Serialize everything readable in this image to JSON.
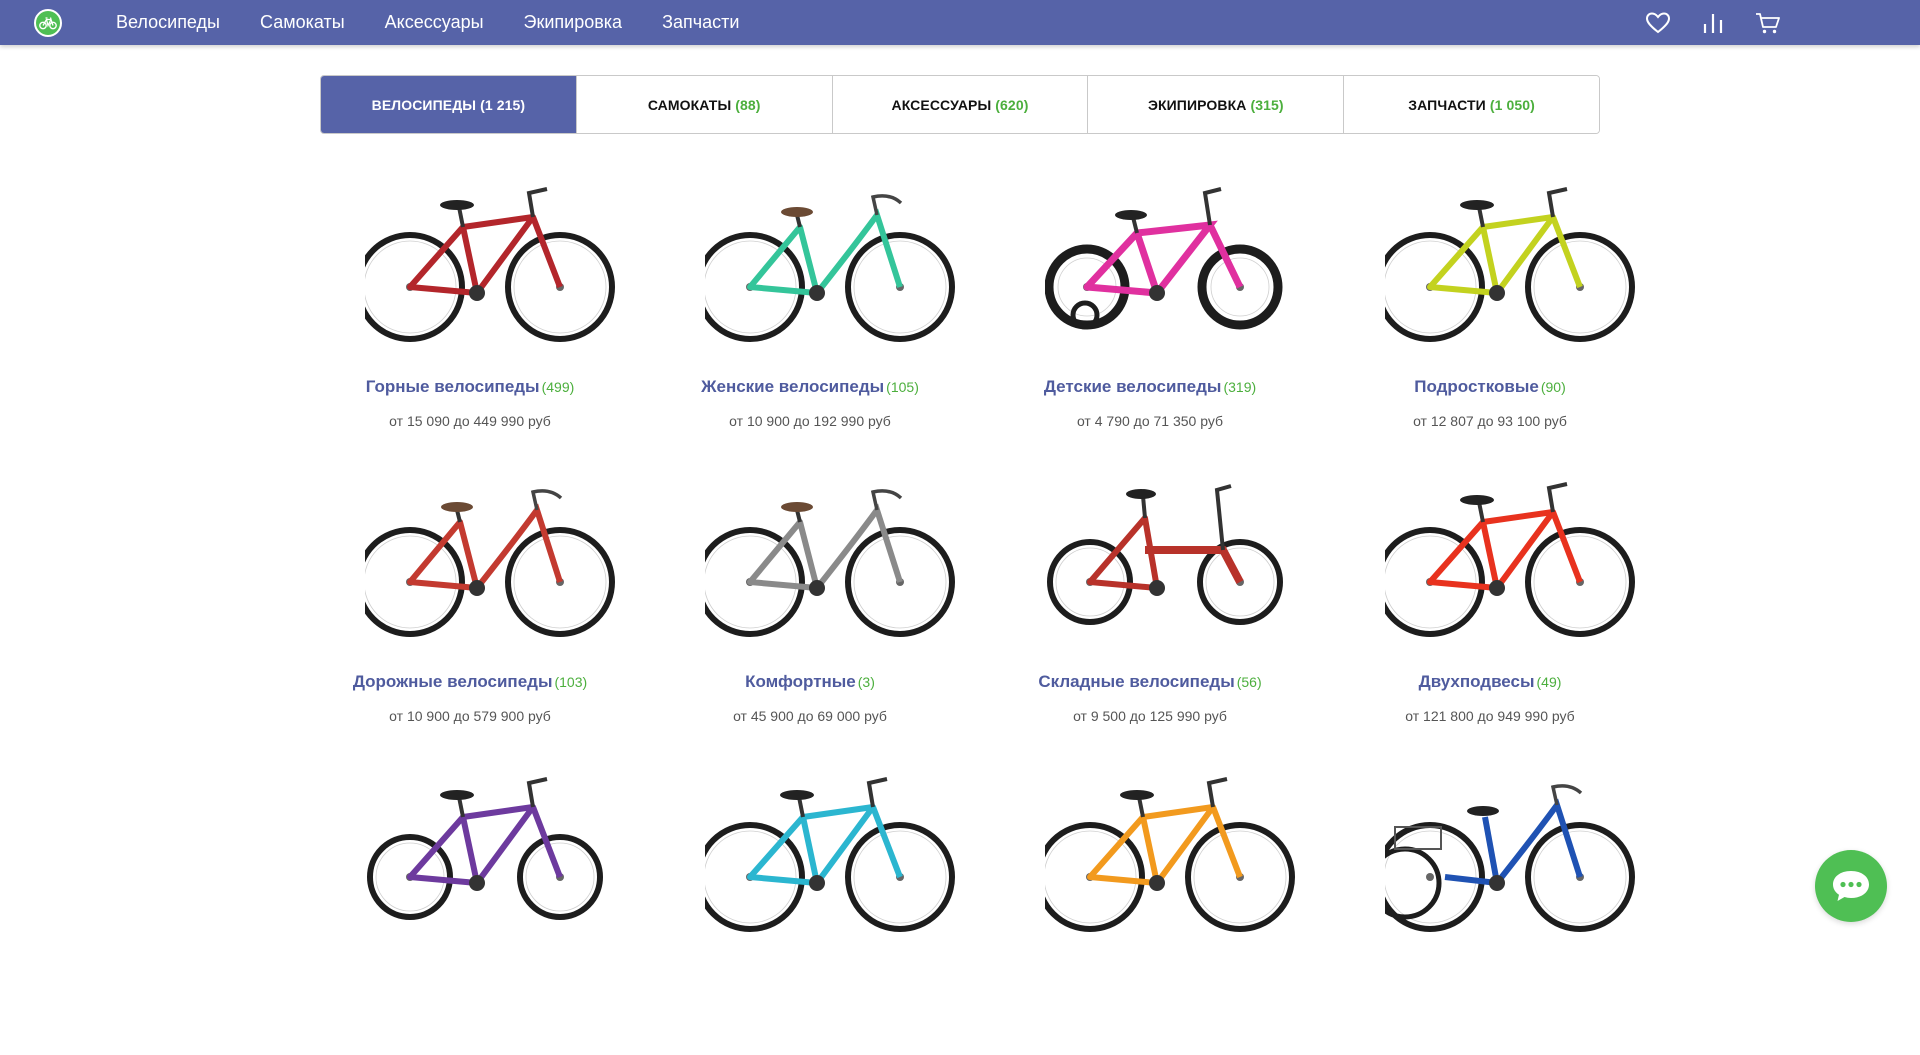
{
  "header": {
    "logo_icon": "bicycle-logo-icon",
    "nav": [
      {
        "label": "Велосипеды"
      },
      {
        "label": "Самокаты"
      },
      {
        "label": "Аксессуары"
      },
      {
        "label": "Экипировка"
      },
      {
        "label": "Запчасти"
      }
    ],
    "icons": [
      "heart-icon",
      "compare-icon",
      "cart-icon"
    ]
  },
  "tabs": [
    {
      "label": "ВЕЛОСИПЕДЫ",
      "count": "(1 215)",
      "active": true
    },
    {
      "label": "САМОКАТЫ",
      "count": "(88)",
      "active": false
    },
    {
      "label": "АКСЕССУАРЫ",
      "count": "(620)",
      "active": false
    },
    {
      "label": "ЭКИПИРОВКА",
      "count": "(315)",
      "active": false
    },
    {
      "label": "ЗАПЧАСТИ",
      "count": "(1 050)",
      "active": false
    }
  ],
  "products": [
    {
      "title": "Горные велосипеды",
      "count": "(499)",
      "price": "от 15 090 до 449 990 руб",
      "color": "#b3262b",
      "kind": "mtb"
    },
    {
      "title": "Женские велосипеды",
      "count": "(105)",
      "price": "от 10 900 до 192 990 руб",
      "color": "#34c59a",
      "kind": "city"
    },
    {
      "title": "Детские велосипеды",
      "count": "(319)",
      "price": "от 4 790 до 71 350 руб",
      "color": "#e0309f",
      "kind": "kids"
    },
    {
      "title": "Подростковые",
      "count": "(90)",
      "price": "от 12 807 до 93 100 руб",
      "color": "#c3d21f",
      "kind": "mtb"
    },
    {
      "title": "Дорожные велосипеды",
      "count": "(103)",
      "price": "от 10 900 до 579 900 руб",
      "color": "#c33a30",
      "kind": "city"
    },
    {
      "title": "Комфортные",
      "count": "(3)",
      "price": "от 45 900 до 69 000 руб",
      "color": "#8a8a8a",
      "kind": "cruiser"
    },
    {
      "title": "Складные велосипеды",
      "count": "(56)",
      "price": "от 9 500 до 125 990 руб",
      "color": "#b8322a",
      "kind": "folding"
    },
    {
      "title": "Двухподвесы",
      "count": "(49)",
      "price": "от 121 800 до 949 990 руб",
      "color": "#e8321e",
      "kind": "mtb"
    },
    {
      "title": "",
      "count": "",
      "price": "",
      "color": "#6d3a9e",
      "kind": "bmx"
    },
    {
      "title": "",
      "count": "",
      "price": "",
      "color": "#2bb6d0",
      "kind": "mtb"
    },
    {
      "title": "",
      "count": "",
      "price": "",
      "color": "#f29a1e",
      "kind": "road"
    },
    {
      "title": "",
      "count": "",
      "price": "",
      "color": "#1f52b3",
      "kind": "trike"
    }
  ],
  "chat_icon": "chat-bubble-icon",
  "colors": {
    "brand": "#5663a8",
    "accent": "#4fbf54",
    "count": "#4caf3d"
  }
}
